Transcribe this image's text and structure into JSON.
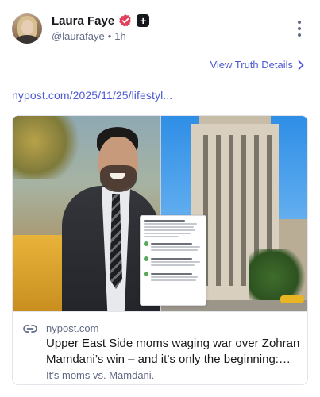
{
  "post": {
    "author": {
      "display_name": "Laura Faye",
      "handle": "@laurafaye",
      "separator": "•",
      "time_ago": "1h",
      "verified_icon": "verified-badge-icon",
      "plus_icon": "plus-badge-icon"
    },
    "more_icon": "more-vertical-icon",
    "truth_details_label": "View Truth Details",
    "link_text": "nypost.com/2025/11/25/lifestyl...",
    "card": {
      "domain": "nypost.com",
      "title": "Upper East Side moms waging war over Zohran Mamdani’s win – and it’s only the beginning: ‘H...",
      "description": "It’s moms vs. Mamdani.",
      "link_icon": "link-icon"
    }
  },
  "colors": {
    "accent": "#4e5ad2",
    "verified": "#e0405c",
    "muted_text": "#606a85",
    "text": "#17181c"
  }
}
